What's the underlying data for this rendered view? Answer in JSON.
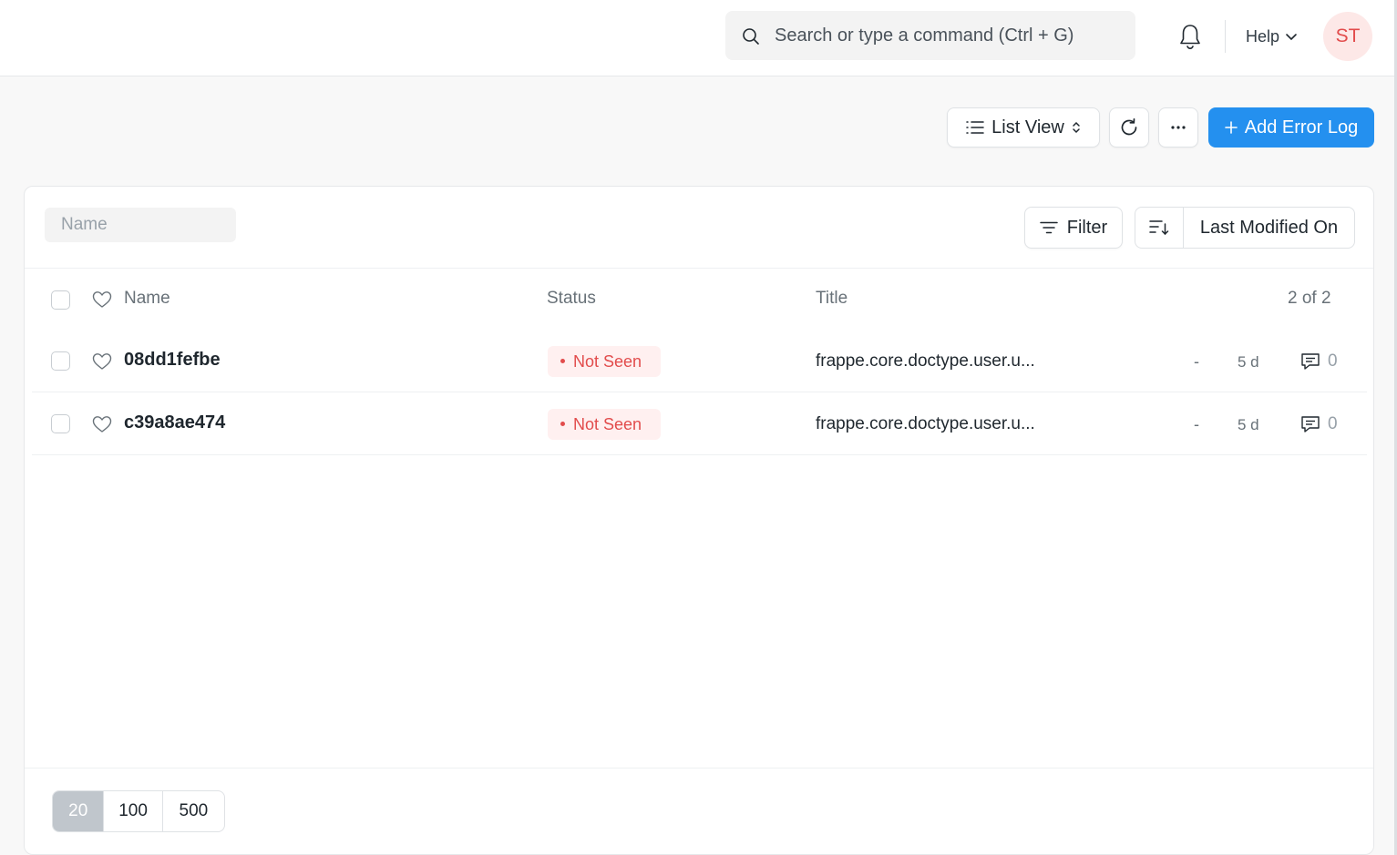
{
  "navbar": {
    "search_placeholder": "Search or type a command (Ctrl + G)",
    "help_label": "Help",
    "avatar_initials": "ST"
  },
  "actions": {
    "list_view_label": "List View",
    "add_label": "Add Error Log"
  },
  "filters": {
    "name_placeholder": "Name",
    "filter_label": "Filter",
    "sort_label": "Last Modified On"
  },
  "table": {
    "headers": {
      "name": "Name",
      "status": "Status",
      "title": "Title",
      "count": "2 of 2"
    },
    "rows": [
      {
        "name": "08dd1fefbe",
        "status": "Not Seen",
        "title": "frappe.core.doctype.user.u...",
        "dash": "-",
        "modified": "5 d",
        "comments": "0"
      },
      {
        "name": "c39a8ae474",
        "status": "Not Seen",
        "title": "frappe.core.doctype.user.u...",
        "dash": "-",
        "modified": "5 d",
        "comments": "0"
      }
    ]
  },
  "pagination": {
    "sizes": [
      "20",
      "100",
      "500"
    ],
    "active": "20"
  },
  "colors": {
    "primary": "#2490ef",
    "status_red": "#e24c4c",
    "status_red_bg": "#fff0f0"
  }
}
